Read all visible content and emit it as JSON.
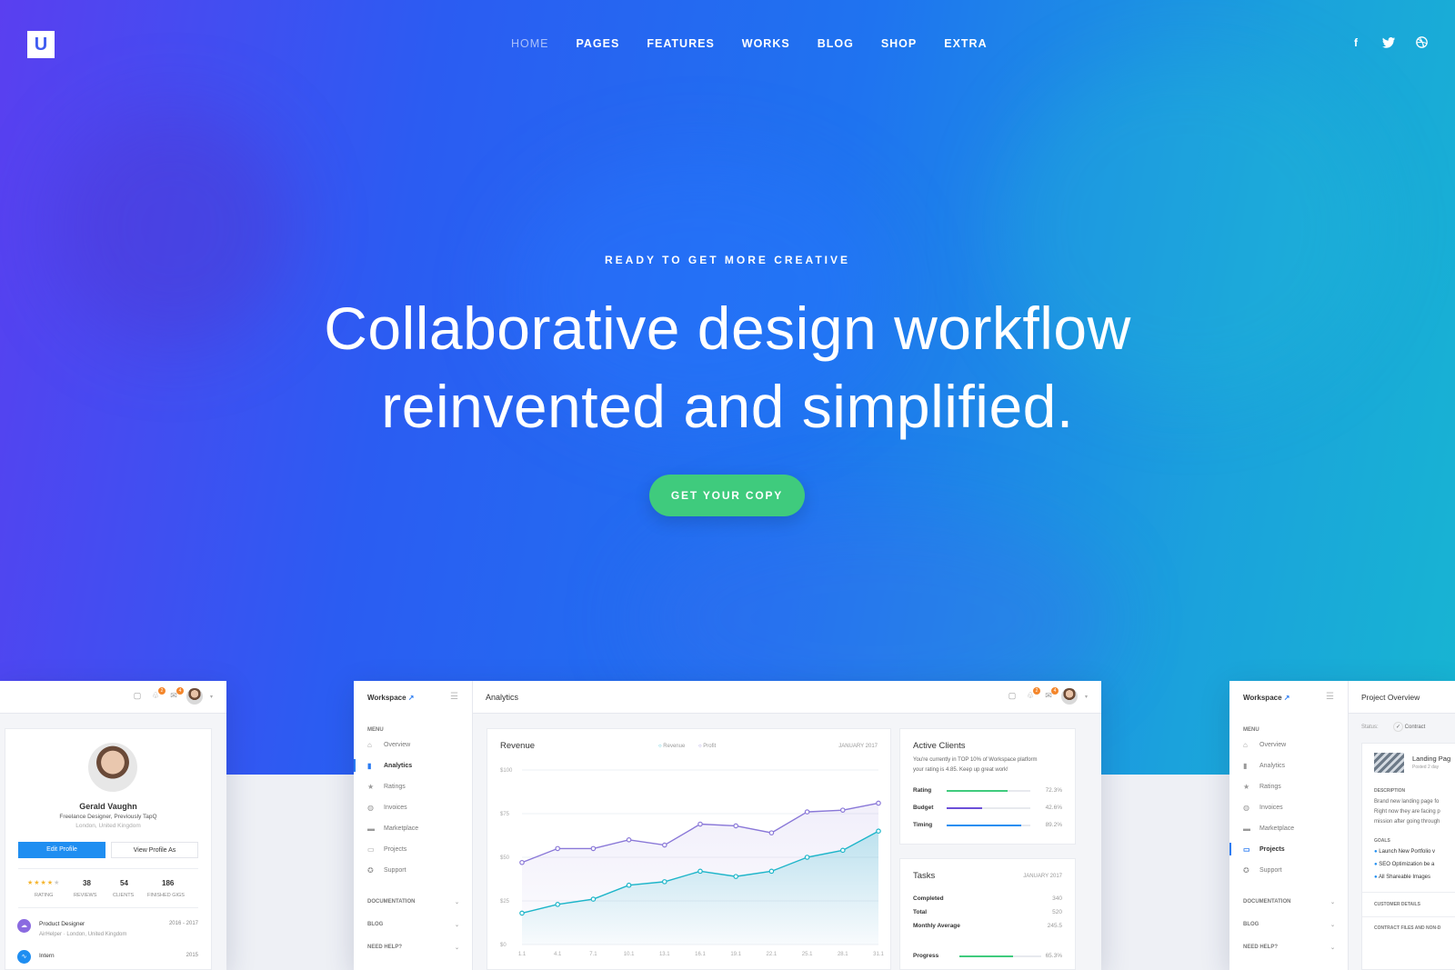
{
  "brand": {
    "logo_letter": "U"
  },
  "nav": {
    "items": [
      "HOME",
      "PAGES",
      "FEATURES",
      "WORKS",
      "BLOG",
      "SHOP",
      "EXTRA"
    ],
    "active": "HOME"
  },
  "social": {
    "facebook": "f",
    "twitter": "t",
    "dribbble": "d"
  },
  "hero": {
    "eyebrow": "READY TO GET MORE CREATIVE",
    "headline_line1": "Collaborative design workflow",
    "headline_line2": "reinvented and simplified.",
    "cta": "GET YOUR COPY"
  },
  "colors": {
    "accent": "#2b7cf2",
    "cta": "#3fcb7d",
    "hero_start": "#5a3ff0",
    "hero_end": "#17b5d2",
    "revenue": "#8a78d8",
    "profit": "#1db5c9"
  },
  "topbar": {
    "badge1": "2",
    "badge2": "4"
  },
  "profile": {
    "name": "Gerald Vaughn",
    "subtitle": "Freelance Designer, Previously TapQ",
    "location": "London, United Kingdom",
    "edit_button": "Edit Profile",
    "view_button": "View Profile As",
    "rating_label": "RATING",
    "reviews_value": "38",
    "reviews_label": "REVIEWS",
    "clients_value": "54",
    "clients_label": "CLIENTS",
    "gigs_value": "186",
    "gigs_label": "FINISHED GIGS",
    "job1_title": "Product Designer",
    "job1_years": "2016 - 2017",
    "job1_place": "AirHelper · London, United Kingdom",
    "job2_title": "Intern",
    "job2_years": "2015"
  },
  "workspace": {
    "label": "Workspace",
    "menu_header": "MENU",
    "menu": [
      "Overview",
      "Analytics",
      "Ratings",
      "Invoices",
      "Marketplace",
      "Projects",
      "Support"
    ],
    "documentation": "DOCUMENTATION",
    "blog": "BLOG",
    "need_help": "NEED HELP?"
  },
  "analytics": {
    "page_title": "Analytics",
    "revenue_title": "Revenue",
    "legend_revenue": "Revenue",
    "legend_profit": "Profit",
    "date": "JANUARY 2017",
    "active_clients_title": "Active Clients",
    "active_clients_text1": "You're currently in TOP 10% of Workspace platform",
    "active_clients_text2": "your rating is 4.85. Keep up great work!",
    "stats": [
      {
        "label": "Rating",
        "value": "72.3%",
        "fill": 0.723,
        "color": "#3fcb7d"
      },
      {
        "label": "Budget",
        "value": "42.6%",
        "fill": 0.426,
        "color": "#6b4fd8"
      },
      {
        "label": "Timing",
        "value": "89.2%",
        "fill": 0.892,
        "color": "#1f8ef1"
      }
    ],
    "tasks_title": "Tasks",
    "tasks_date": "JANUARY 2017",
    "tasks": [
      {
        "label": "Completed",
        "value": "340"
      },
      {
        "label": "Total",
        "value": "520"
      },
      {
        "label": "Monthly Average",
        "value": "245.5"
      }
    ],
    "progress_label": "Progress",
    "progress_value": "65.3%",
    "progress_fill": 0.653
  },
  "chart_data": {
    "type": "line",
    "title": "Revenue",
    "categories": [
      "1.1",
      "4.1",
      "7.1",
      "10.1",
      "13.1",
      "16.1",
      "19.1",
      "22.1",
      "25.1",
      "28.1",
      "31.1"
    ],
    "yticks": [
      "$0",
      "$25",
      "$50",
      "$75",
      "$100"
    ],
    "ylim": [
      0,
      100
    ],
    "series": [
      {
        "name": "Revenue",
        "color": "#8a78d8",
        "values": [
          47,
          55,
          55,
          60,
          57,
          69,
          68,
          64,
          76,
          77,
          81
        ]
      },
      {
        "name": "Profit",
        "color": "#1db5c9",
        "values": [
          18,
          23,
          26,
          34,
          36,
          42,
          39,
          42,
          50,
          54,
          65
        ]
      }
    ]
  },
  "project": {
    "title": "Project Overview",
    "status_label": "Status:",
    "status_value": "Contract",
    "card_title": "Landing Pag",
    "posted": "Posted 2 day",
    "description_label": "DESCRIPTION",
    "desc1": "Brand new landing page fo",
    "desc2": "Right now they are facing p",
    "desc3": "mission after going through",
    "goals_label": "GOALS",
    "goals": [
      "Launch New Portfolio v",
      "SEO Optimization be a",
      "All Shareable Images"
    ],
    "customer_details": "CUSTOMER DETAILS",
    "contract_files": "CONTRACT FILES AND NON-D"
  }
}
